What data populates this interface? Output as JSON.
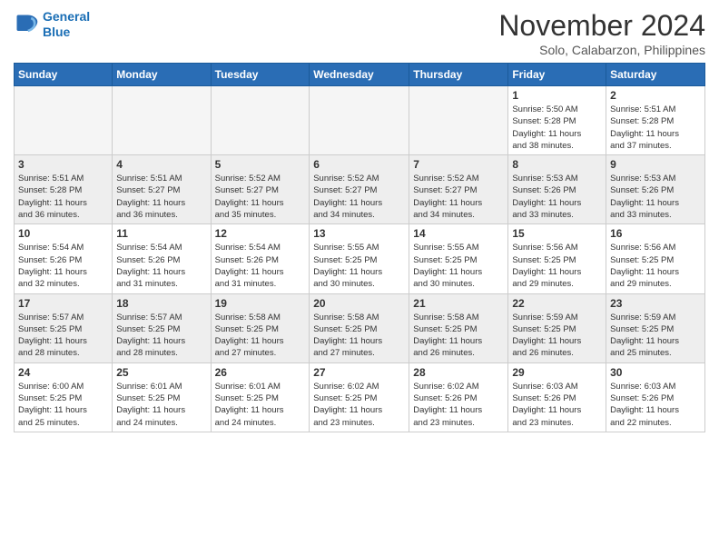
{
  "logo": {
    "line1": "General",
    "line2": "Blue"
  },
  "title": "November 2024",
  "location": "Solo, Calabarzon, Philippines",
  "headers": [
    "Sunday",
    "Monday",
    "Tuesday",
    "Wednesday",
    "Thursday",
    "Friday",
    "Saturday"
  ],
  "rows": [
    [
      {
        "day": "",
        "info": ""
      },
      {
        "day": "",
        "info": ""
      },
      {
        "day": "",
        "info": ""
      },
      {
        "day": "",
        "info": ""
      },
      {
        "day": "",
        "info": ""
      },
      {
        "day": "1",
        "info": "Sunrise: 5:50 AM\nSunset: 5:28 PM\nDaylight: 11 hours\nand 38 minutes."
      },
      {
        "day": "2",
        "info": "Sunrise: 5:51 AM\nSunset: 5:28 PM\nDaylight: 11 hours\nand 37 minutes."
      }
    ],
    [
      {
        "day": "3",
        "info": "Sunrise: 5:51 AM\nSunset: 5:28 PM\nDaylight: 11 hours\nand 36 minutes."
      },
      {
        "day": "4",
        "info": "Sunrise: 5:51 AM\nSunset: 5:27 PM\nDaylight: 11 hours\nand 36 minutes."
      },
      {
        "day": "5",
        "info": "Sunrise: 5:52 AM\nSunset: 5:27 PM\nDaylight: 11 hours\nand 35 minutes."
      },
      {
        "day": "6",
        "info": "Sunrise: 5:52 AM\nSunset: 5:27 PM\nDaylight: 11 hours\nand 34 minutes."
      },
      {
        "day": "7",
        "info": "Sunrise: 5:52 AM\nSunset: 5:27 PM\nDaylight: 11 hours\nand 34 minutes."
      },
      {
        "day": "8",
        "info": "Sunrise: 5:53 AM\nSunset: 5:26 PM\nDaylight: 11 hours\nand 33 minutes."
      },
      {
        "day": "9",
        "info": "Sunrise: 5:53 AM\nSunset: 5:26 PM\nDaylight: 11 hours\nand 33 minutes."
      }
    ],
    [
      {
        "day": "10",
        "info": "Sunrise: 5:54 AM\nSunset: 5:26 PM\nDaylight: 11 hours\nand 32 minutes."
      },
      {
        "day": "11",
        "info": "Sunrise: 5:54 AM\nSunset: 5:26 PM\nDaylight: 11 hours\nand 31 minutes."
      },
      {
        "day": "12",
        "info": "Sunrise: 5:54 AM\nSunset: 5:26 PM\nDaylight: 11 hours\nand 31 minutes."
      },
      {
        "day": "13",
        "info": "Sunrise: 5:55 AM\nSunset: 5:25 PM\nDaylight: 11 hours\nand 30 minutes."
      },
      {
        "day": "14",
        "info": "Sunrise: 5:55 AM\nSunset: 5:25 PM\nDaylight: 11 hours\nand 30 minutes."
      },
      {
        "day": "15",
        "info": "Sunrise: 5:56 AM\nSunset: 5:25 PM\nDaylight: 11 hours\nand 29 minutes."
      },
      {
        "day": "16",
        "info": "Sunrise: 5:56 AM\nSunset: 5:25 PM\nDaylight: 11 hours\nand 29 minutes."
      }
    ],
    [
      {
        "day": "17",
        "info": "Sunrise: 5:57 AM\nSunset: 5:25 PM\nDaylight: 11 hours\nand 28 minutes."
      },
      {
        "day": "18",
        "info": "Sunrise: 5:57 AM\nSunset: 5:25 PM\nDaylight: 11 hours\nand 28 minutes."
      },
      {
        "day": "19",
        "info": "Sunrise: 5:58 AM\nSunset: 5:25 PM\nDaylight: 11 hours\nand 27 minutes."
      },
      {
        "day": "20",
        "info": "Sunrise: 5:58 AM\nSunset: 5:25 PM\nDaylight: 11 hours\nand 27 minutes."
      },
      {
        "day": "21",
        "info": "Sunrise: 5:58 AM\nSunset: 5:25 PM\nDaylight: 11 hours\nand 26 minutes."
      },
      {
        "day": "22",
        "info": "Sunrise: 5:59 AM\nSunset: 5:25 PM\nDaylight: 11 hours\nand 26 minutes."
      },
      {
        "day": "23",
        "info": "Sunrise: 5:59 AM\nSunset: 5:25 PM\nDaylight: 11 hours\nand 25 minutes."
      }
    ],
    [
      {
        "day": "24",
        "info": "Sunrise: 6:00 AM\nSunset: 5:25 PM\nDaylight: 11 hours\nand 25 minutes."
      },
      {
        "day": "25",
        "info": "Sunrise: 6:01 AM\nSunset: 5:25 PM\nDaylight: 11 hours\nand 24 minutes."
      },
      {
        "day": "26",
        "info": "Sunrise: 6:01 AM\nSunset: 5:25 PM\nDaylight: 11 hours\nand 24 minutes."
      },
      {
        "day": "27",
        "info": "Sunrise: 6:02 AM\nSunset: 5:25 PM\nDaylight: 11 hours\nand 23 minutes."
      },
      {
        "day": "28",
        "info": "Sunrise: 6:02 AM\nSunset: 5:26 PM\nDaylight: 11 hours\nand 23 minutes."
      },
      {
        "day": "29",
        "info": "Sunrise: 6:03 AM\nSunset: 5:26 PM\nDaylight: 11 hours\nand 23 minutes."
      },
      {
        "day": "30",
        "info": "Sunrise: 6:03 AM\nSunset: 5:26 PM\nDaylight: 11 hours\nand 22 minutes."
      }
    ]
  ]
}
